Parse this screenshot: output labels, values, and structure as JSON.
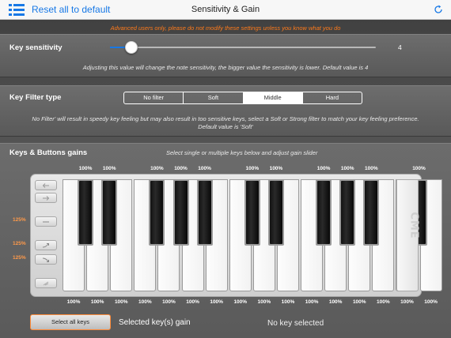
{
  "nav": {
    "reset_label": "Reset all to default",
    "title": "Sensitivity & Gain",
    "menu_icon": "list-icon",
    "refresh_icon": "refresh-icon",
    "accent_color": "#1778e6"
  },
  "warning": "Advanced users only, please do not modify these settings unless you know what you do",
  "sensitivity": {
    "label": "Key sensitivity",
    "value": "4",
    "level_fraction": 0.08,
    "description": "Adjusting this value will change the note sensitivity, the bigger value the sensitivity is lower. Default value is 4"
  },
  "filter": {
    "label": "Key Filter type",
    "options": [
      "No filter",
      "Soft",
      "Middle",
      "Hard"
    ],
    "selected": "Middle",
    "description_line1": "No Filter' will result in speedy key feeling but may also result in too sensitive keys, select a Soft or Strong filter to match your key feeling preference.",
    "description_line2": "Default value is 'Soft'"
  },
  "gains": {
    "label": "Keys & Buttons gains",
    "hint": "Select single or multiple keys below and adjust gain slider",
    "black_key_gains": [
      "100%",
      "100%",
      "100%",
      "100%",
      "100%",
      "100%",
      "100%",
      "100%",
      "100%",
      "100%",
      "100%",
      "100%"
    ],
    "white_key_gains": [
      "100%",
      "100%",
      "100%",
      "100%",
      "100%",
      "100%",
      "100%",
      "100%",
      "100%",
      "100%",
      "100%",
      "100%",
      "100%",
      "100%",
      "100%",
      "100%"
    ],
    "button_gains": [
      "125%",
      "125%",
      "125%"
    ],
    "logo": "CME",
    "select_all_label": "Select all keys",
    "selected_gain_label": "Selected key(s) gain",
    "no_key_label": "No key selected",
    "highlight_color": "#ff8c3a"
  }
}
